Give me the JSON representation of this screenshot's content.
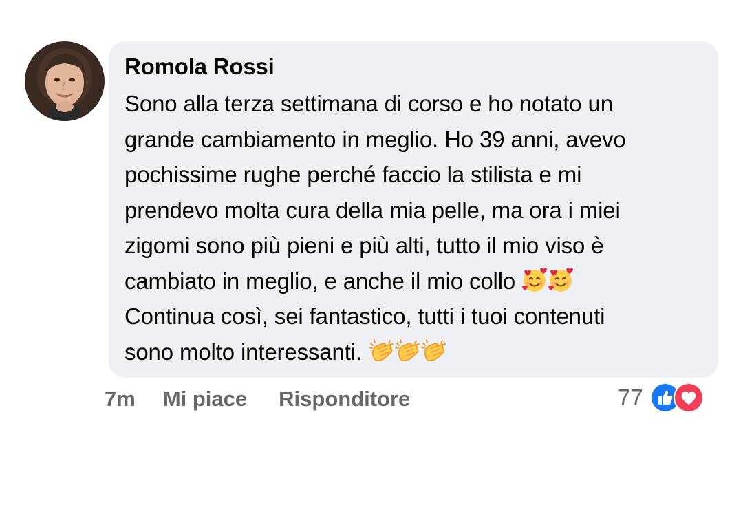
{
  "comment": {
    "author": "Romola Rossi",
    "avatar_icon": "user-avatar-photo",
    "lines": [
      "Sono alla terza settimana di corso e ho notato un",
      "grande cambiamento in meglio. Ho 39 anni, avevo",
      "pochissime rughe perché faccio la stilista e mi",
      "prendevo molta cura della mia pelle, ma ora i miei",
      "zigomi sono più pieni e più alti, tutto il mio viso è",
      "cambiato in meglio, e anche il mio collo",
      "Continua così, sei fantastico, tutti i tuoi contenuti",
      "sono molto interessanti."
    ],
    "emojis": {
      "line6": [
        "smiling-face-with-hearts",
        "smiling-face-with-hearts"
      ],
      "line8": [
        "clapping-hands",
        "clapping-hands",
        "clapping-hands"
      ]
    },
    "bubble_color": "#eff0f4"
  },
  "actions": {
    "time": "7m",
    "like_label": "Mi piace",
    "reply_label": "Risponditore"
  },
  "reactions": {
    "count": "77",
    "icons": [
      "like-reaction-icon",
      "love-reaction-icon"
    ],
    "like_color": "#1877f2",
    "love_color": "#f33e58"
  }
}
